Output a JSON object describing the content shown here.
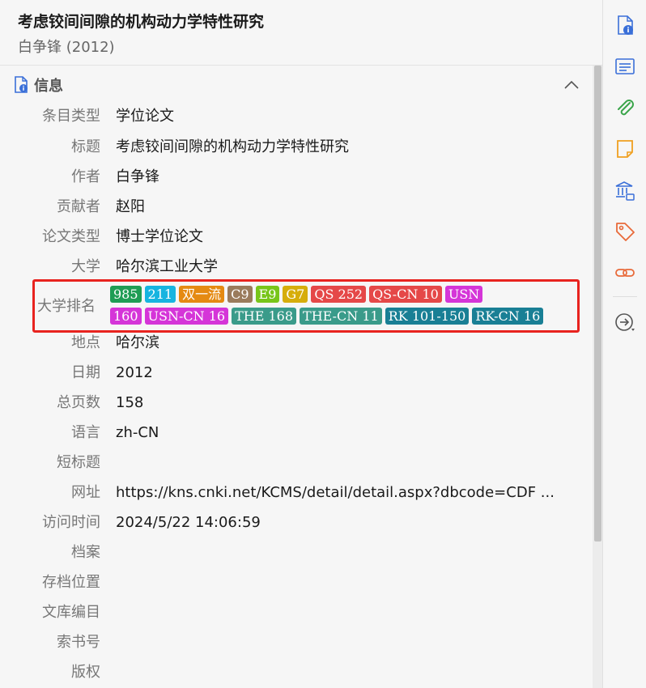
{
  "header": {
    "title": "考虑铰间间隙的机构动力学特性研究",
    "subtitle": "白争锋 (2012)"
  },
  "section": {
    "title": "信息"
  },
  "fields": [
    {
      "label": "条目类型",
      "value": "学位论文"
    },
    {
      "label": "标题",
      "value": "考虑铰间间隙的机构动力学特性研究"
    },
    {
      "label": "作者",
      "value": "白争锋"
    },
    {
      "label": "贡献者",
      "value": "赵阳"
    },
    {
      "label": "论文类型",
      "value": "博士学位论文"
    },
    {
      "label": "大学",
      "value": "哈尔滨工业大学"
    }
  ],
  "ranking": {
    "label": "大学排名",
    "line1": [
      {
        "text": "985",
        "color": "#1f9d55"
      },
      {
        "text": "211",
        "color": "#17b4e0"
      },
      {
        "text": "双一流",
        "color": "#e58a12"
      },
      {
        "text": "C9",
        "color": "#9a7b5c"
      },
      {
        "text": "E9",
        "color": "#78c51a"
      },
      {
        "text": "G7",
        "color": "#d6ad0b"
      },
      {
        "text": "QS 252",
        "color": "#e54848"
      },
      {
        "text": "QS-CN 10",
        "color": "#e54848"
      },
      {
        "text": "USN",
        "color": "#d535d8"
      }
    ],
    "line2": [
      {
        "text": "160",
        "color": "#d535d8"
      },
      {
        "text": "USN-CN 16",
        "color": "#d535d8"
      },
      {
        "text": "THE 168",
        "color": "#3a9b8a"
      },
      {
        "text": "THE-CN 11",
        "color": "#3a9b8a"
      },
      {
        "text": "RK 101-150",
        "color": "#197f95"
      },
      {
        "text": "RK-CN 16",
        "color": "#197f95"
      }
    ]
  },
  "fields2": [
    {
      "label": "地点",
      "value": "哈尔滨"
    },
    {
      "label": "日期",
      "value": "2012"
    },
    {
      "label": "总页数",
      "value": "158"
    },
    {
      "label": "语言",
      "value": "zh-CN"
    },
    {
      "label": "短标题",
      "value": ""
    },
    {
      "label": "网址",
      "value": "https://kns.cnki.net/KCMS/detail/detail.aspx?dbcode=CDF ..."
    },
    {
      "label": "访问时间",
      "value": "2024/5/22 14:06:59"
    },
    {
      "label": "档案",
      "value": ""
    },
    {
      "label": "存档位置",
      "value": ""
    },
    {
      "label": "文库编目",
      "value": ""
    },
    {
      "label": "索书号",
      "value": ""
    },
    {
      "label": "版权",
      "value": ""
    }
  ],
  "sidebar": [
    {
      "name": "info-doc-icon",
      "color": "#3a6fd8"
    },
    {
      "name": "abstract-icon",
      "color": "#3a6fd8"
    },
    {
      "name": "attachment-icon",
      "color": "#3aa54a"
    },
    {
      "name": "note-icon",
      "color": "#f0a020"
    },
    {
      "name": "library-icon",
      "color": "#3a6fd8"
    },
    {
      "name": "tag-icon",
      "color": "#e86a3a"
    },
    {
      "name": "related-icon",
      "color": "#e86a3a"
    },
    {
      "name": "locate-icon",
      "color": "#555555"
    }
  ]
}
